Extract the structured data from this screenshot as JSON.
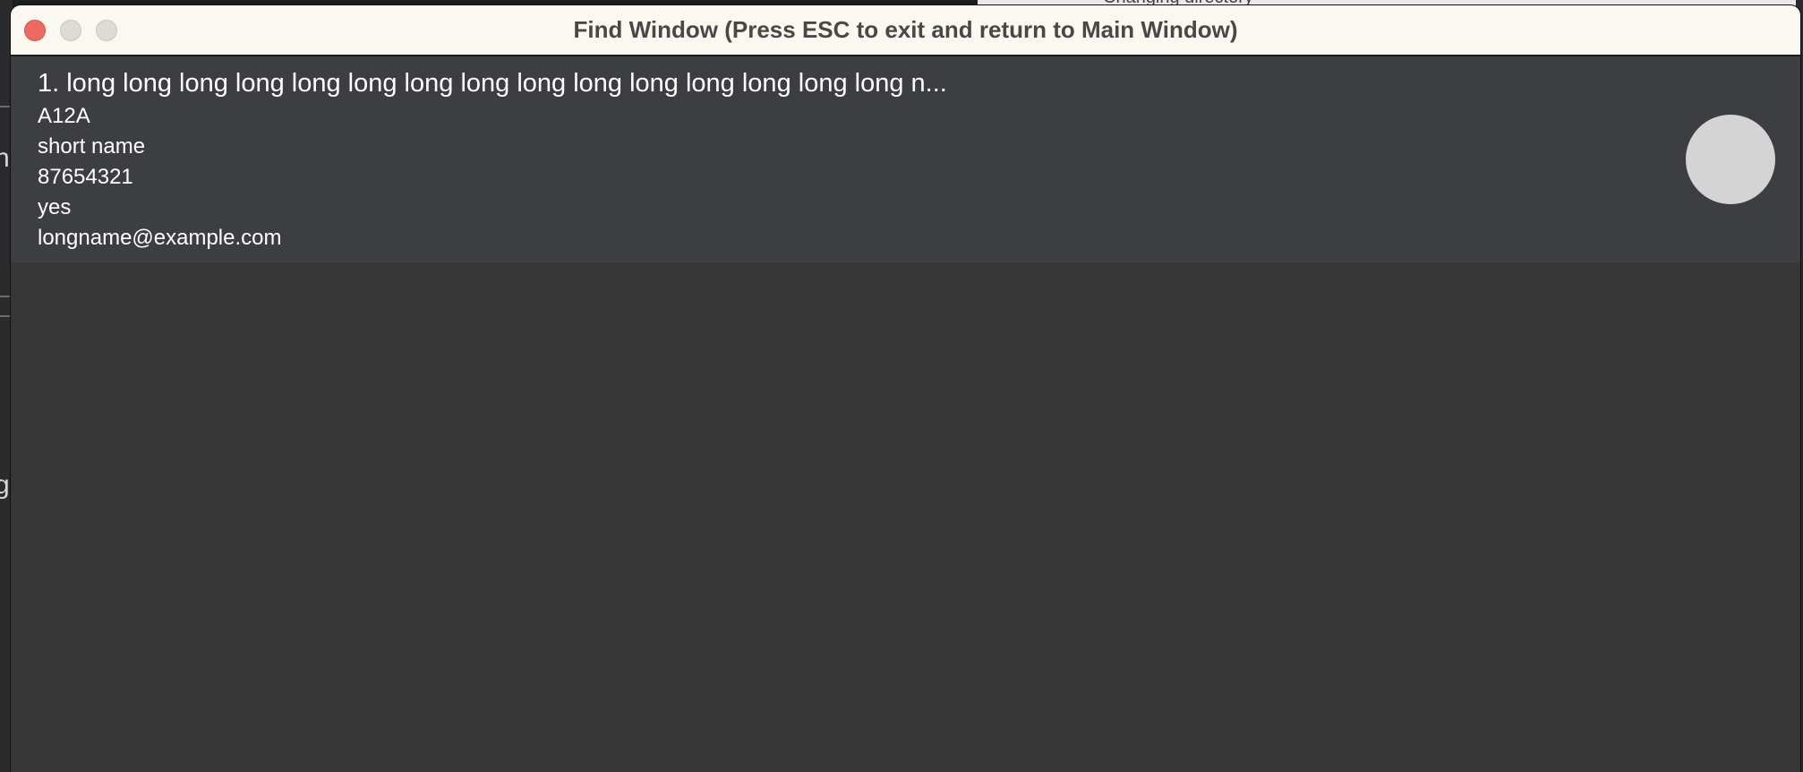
{
  "window": {
    "title": "Find Window (Press ESC to exit and return to Main Window)"
  },
  "background": {
    "right_fragment": "Changing directory",
    "left_fragments": [
      "nt",
      "g"
    ]
  },
  "results": [
    {
      "index_name": "1. long long long long long long long long long long long long long long long n...",
      "code": "A12A",
      "short_name": "short name",
      "phone": "87654321",
      "status": "yes",
      "email": "longname@example.com"
    }
  ],
  "colors": {
    "titlebar": "#fbf8f1",
    "window_bg": "#363636",
    "card_bg": "#3c3e41",
    "avatar": "#d4d4d4",
    "close": "#ed6a5e"
  }
}
